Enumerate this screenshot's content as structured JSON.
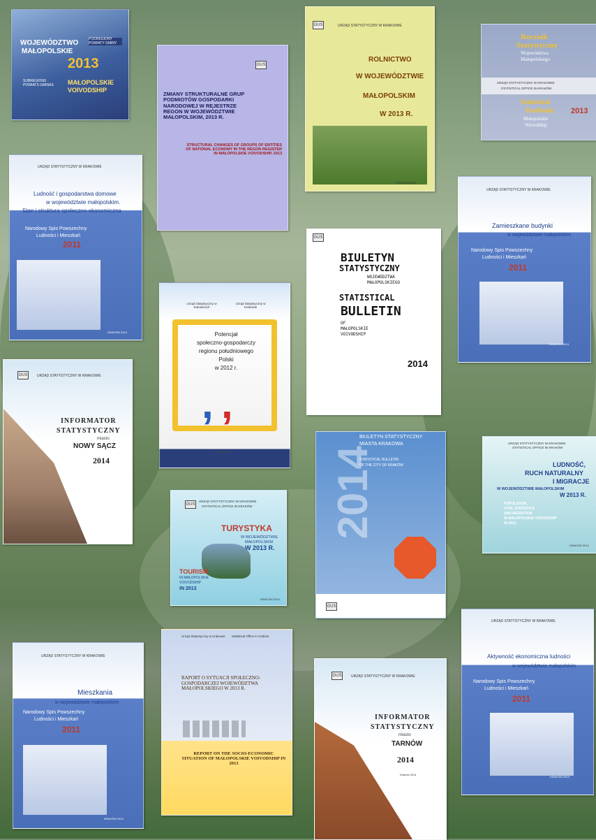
{
  "books": {
    "b1": {
      "line1": "WOJEWÓDZTWO",
      "line2": "MAŁOPOLSKIE",
      "year": "2013",
      "line3": "MAŁOPOLSKIE",
      "line4": "VOIVODSHIP",
      "side1": "PODREGIONY POWIATY GMINY",
      "side2": "SUBREGIONS POWIATS GMINAS"
    },
    "b2": {
      "pl": "ZMIANY STRUKTURALNE GRUP PODMIOTÓW GOSPODARKI NARODOWEJ W REJESTRZE REGON W WOJEWÓDZTWIE MAŁOPOLSKIM, 2013 R.",
      "en": "STRUCTURAL CHANGES OF GROUPS OF ENTITIES OF NATIONAL ECONOMY IN THE REGON REGISTER IN MAŁOPOLSKIE VOIVODSHIP, 2013"
    },
    "b3": {
      "header": "URZĄD STATYSTYCZNY W KRAKOWIE",
      "l1": "ROLNICTWO",
      "l2": "W WOJEWÓDZTWIE",
      "l3": "MAŁOPOLSKIM",
      "l4": "W 2013 R.",
      "foot": "KRAKÓW 2014"
    },
    "b4": {
      "l1": "Rocznik",
      "l2": "Statystyczny",
      "l3": "Województwa",
      "l4": "Małopolskiego",
      "m1": "URZĄD STATYSTYCZNY W KRAKOWIE",
      "m2": "STATISTICAL OFFICE IN KRAKÓW",
      "l5": "Statistical",
      "l6": "Yearbook",
      "l7": "Małopolskie",
      "l8": "Voivodship",
      "year": "2013"
    },
    "b5": {
      "header": "URZĄD STATYSTYCZNY W KRAKOWIE",
      "t1": "Ludność i gospodarstwa domowe",
      "t2": "w województwie małopolskim.",
      "t3": "Stan i struktura społeczno-ekonomiczna",
      "n1": "Narodowy Spis Powszechny",
      "n2": "Ludności i Mieszkań",
      "year": "2011",
      "foot": "KRAKÓW 2014"
    },
    "b6": {
      "header": "URZĄD STATYSTYCZNY W KRAKOWIE",
      "t1": "Zamieszkane budynki",
      "t2": "w województwie małopolskim",
      "n1": "Narodowy Spis Powszechny",
      "n2": "Ludności i Mieszkań",
      "year": "2011",
      "foot": "KRAKÓW 2013"
    },
    "b7": {
      "h1": "Urząd Statystyczny w Katowicach",
      "h2": "Urząd Statystyczny w Krakowie",
      "t1": "Potencjał",
      "t2": "społeczno-gospodarczy",
      "t3": "regionu południowego",
      "t4": "Polski",
      "t5": "w 2012 r.",
      "foot": "Katowice 2014"
    },
    "b8": {
      "l1": "BIULETYN",
      "l2": "STATYSTYCZNY",
      "l3": "WOJEWÓDZTWA",
      "l4": "MAŁOPOLSKIEGO",
      "l5": "STATISTICAL",
      "l6": "BULLETIN",
      "l7": "OF",
      "l8": "MAŁOPOLSKIE",
      "l9": "VOIVODSHIP",
      "year": "2014"
    },
    "b9": {
      "header": "URZĄD STATYSTYCZNY W KRAKOWIE",
      "t1": "INFORMATOR",
      "t2": "STATYSTYCZNY",
      "t3": "miasto",
      "t4": "NOWY SĄCZ",
      "year": "2014"
    },
    "b10": {
      "vyear": "2014",
      "t1": "BIULETYN STATYSTYCZNY",
      "t2": "MIASTA KRAKOWA",
      "t3": "STATISTICAL BULLETIN",
      "t4": "OF THE CITY OF KRAKÓW"
    },
    "b11": {
      "h1": "URZĄD STATYSTYCZNY W KRAKOWIE",
      "h2": "STATISTICAL OFFICE IN KRAKÓW",
      "t1": "LUDNOŚĆ,",
      "t2": "RUCH NATURALNY",
      "t3": "I MIGRACJE",
      "t4": "W WOJEWÓDZTWIE MAŁOPOLSKIM",
      "t5": "W 2013 R.",
      "e1": "POPULATION,",
      "e2": "VITAL STATISTICS",
      "e3": "AND MIGRATION",
      "e4": "IN MAŁOPOLSKIE VOIVODSHIP",
      "e5": "IN 2013",
      "foot": "KRAKÓW 2014"
    },
    "b12": {
      "h1": "URZĄD STATYSTYCZNY W KRAKOWIE",
      "h2": "STATISTICAL OFFICE IN KRAKÓW",
      "t1": "TURYSTYKA",
      "t2": "W WOJEWÓDZTWIE",
      "t3": "MAŁOPOLSKIM",
      "t4": "W 2013 R.",
      "e1": "TOURISM",
      "e2": "IN MAŁOPOLSKIE",
      "e3": "VOIVODSHIP",
      "e4": "IN 2013",
      "foot": "KRAKÓW 2014"
    },
    "b13": {
      "header": "URZĄD STATYSTYCZNY W KRAKOWIE",
      "t1": "Mieszkania",
      "t2": "w województwie małopolskim",
      "n1": "Narodowy Spis Powszechny",
      "n2": "Ludności i Mieszkań",
      "year": "2011",
      "foot": "KRAKÓW 2013"
    },
    "b14": {
      "h1": "Urząd Statystyczny w Krakowie",
      "h2": "Statistical Office in Kraków",
      "pl": "RAPORT O SYTUACJI SPOŁECZNO-GOSPODARCZEJ WOJEWÓDZTWA MAŁOPOLSKIEGO W 2013 R.",
      "en": "REPORT ON THE SOCIO-ECONOMIC SITUATION OF MAŁOPOLSKIE VOIVODSHIP IN 2013"
    },
    "b15": {
      "header": "URZĄD STATYSTYCZNY W KRAKOWIE",
      "t1": "INFORMATOR",
      "t2": "STATYSTYCZNY",
      "t3": "miasto",
      "t4": "TARNÓW",
      "year": "2014",
      "foot": "Kraków 2014"
    },
    "b16": {
      "header": "URZĄD STATYSTYCZNY W KRAKOWIE",
      "t1": "Aktywność ekonomiczna ludności",
      "t2": "w województwie małopolskim",
      "n1": "Narodowy Spis Powszechny",
      "n2": "Ludności i Mieszkań",
      "year": "2011",
      "foot": "KRAKÓW 2013"
    }
  },
  "colors": {
    "nsp_blue": "#5a7fc8",
    "accent_red": "#c0392b",
    "accent_yellow": "#f2c12e",
    "light_green": "#d8e47a"
  }
}
